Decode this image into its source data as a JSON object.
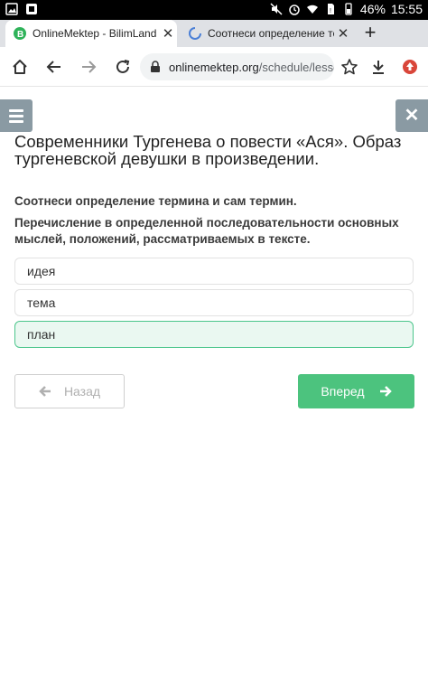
{
  "status_bar": {
    "battery": "46%",
    "time": "15:55"
  },
  "tabs": [
    {
      "title": "OnlineMektep - BilimLand",
      "close": "✕"
    },
    {
      "title": "Соотнеси определение терми",
      "close": "✕"
    }
  ],
  "new_tab": "+",
  "omnibox": {
    "url_host": "onlinemektep.org",
    "url_path": "/schedule/lesso"
  },
  "lesson": {
    "title": "Современники Тургенева о повести «Ася». Образ тургеневской девушки в произведении."
  },
  "question": {
    "instruction": "Соотнеси определение термина и сам термин.",
    "definition": "Перечисление в определенной последовательности основных мыслей, положений, рассматриваемых в тексте."
  },
  "options": [
    {
      "label": "идея",
      "selected": false
    },
    {
      "label": "тема",
      "selected": false
    },
    {
      "label": "план",
      "selected": true
    }
  ],
  "nav": {
    "back_label": "Назад",
    "next_label": "Вперед"
  },
  "colors": {
    "accent_green": "#4cc37e",
    "selected_bg": "#eaf8f1",
    "side_button": "#8a9aa3"
  }
}
